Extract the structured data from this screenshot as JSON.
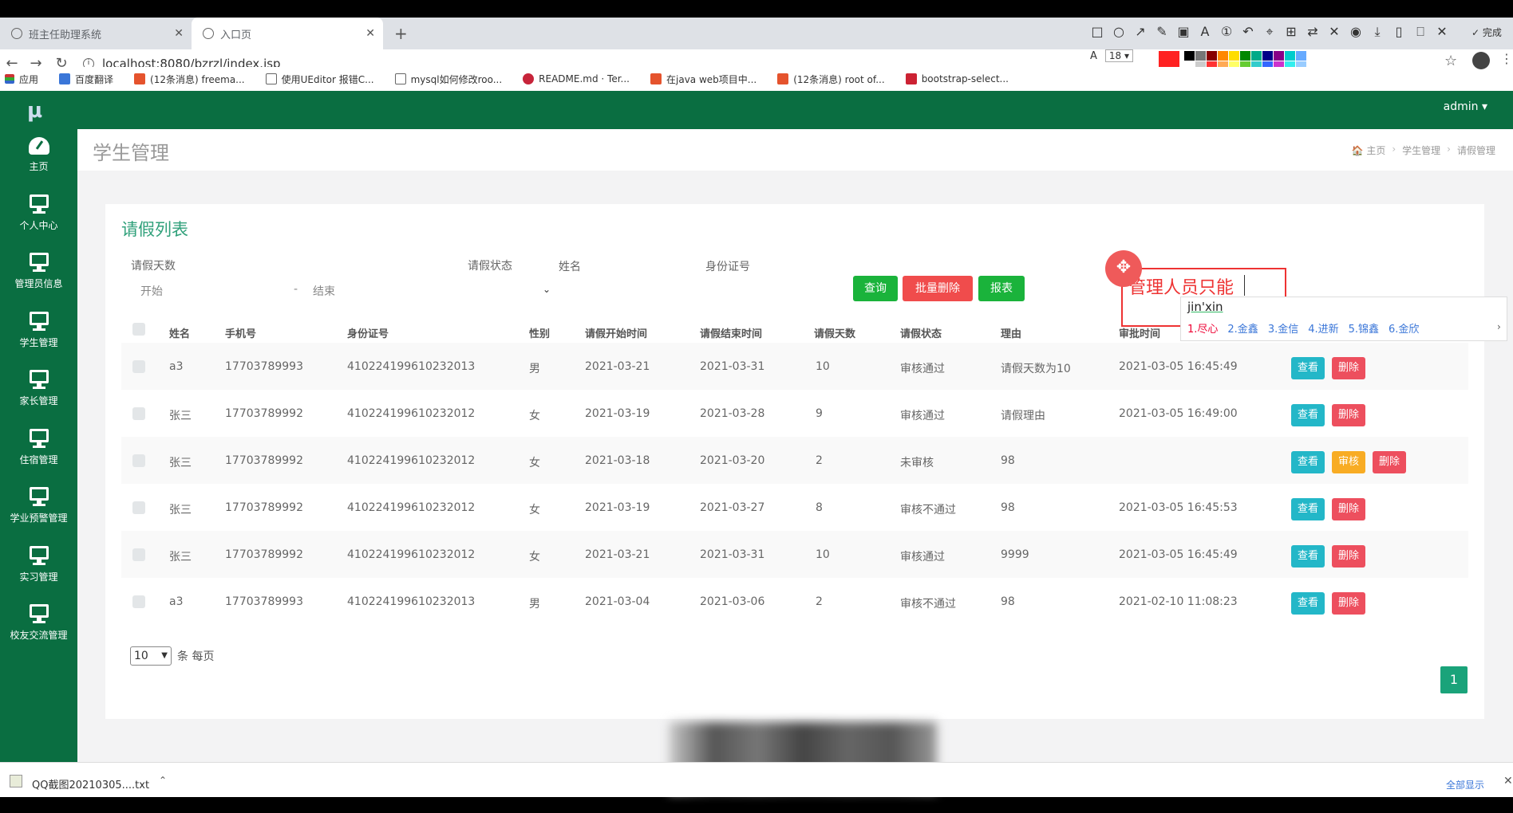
{
  "browser": {
    "tabs": [
      {
        "label": "班主任助理系统"
      },
      {
        "label": "入口页"
      }
    ],
    "url": "localhost:8080/bzrzl/index.jsp",
    "bookmarks": [
      "应用",
      "百度翻译",
      "(12条消息) freema...",
      "使用UEditor 报错C...",
      "mysql如何修改roo...",
      "README.md · Ter...",
      "在java web项目中...",
      "(12条消息) root of...",
      "bootstrap-select..."
    ],
    "snap_tool": {
      "done_label": "完成",
      "font_size": "18"
    }
  },
  "header": {
    "logo": "μ",
    "user": "admin ▾"
  },
  "sidebar": {
    "items": [
      {
        "label": "主页",
        "icon": "dashboard-icon"
      },
      {
        "label": "个人中心",
        "icon": "monitor-icon"
      },
      {
        "label": "管理员信息",
        "icon": "monitor-icon"
      },
      {
        "label": "学生管理",
        "icon": "monitor-icon"
      },
      {
        "label": "家长管理",
        "icon": "monitor-icon"
      },
      {
        "label": "住宿管理",
        "icon": "monitor-icon"
      },
      {
        "label": "学业预警管理",
        "icon": "monitor-icon"
      },
      {
        "label": "实习管理",
        "icon": "monitor-icon"
      },
      {
        "label": "校友交流管理",
        "icon": "monitor-icon"
      }
    ]
  },
  "page": {
    "title": "学生管理",
    "breadcrumbs": [
      "🏠 主页",
      "学生管理",
      "请假管理"
    ]
  },
  "card": {
    "title": "请假列表"
  },
  "filters": {
    "days_label": "请假天数",
    "days_start_placeholder": "开始",
    "days_dash": "-",
    "days_end_placeholder": "结束",
    "status_label": "请假状态",
    "name_label": "姓名",
    "idcard_label": "身份证号",
    "search_button": "查询",
    "batch_delete_button": "批量删除",
    "report_button": "报表"
  },
  "annotation": {
    "text": "管理人员只能",
    "ime_input": "jin'xin",
    "ime_candidates": [
      "1.尽心",
      "2.金鑫",
      "3.金信",
      "4.进新",
      "5.锦鑫",
      "6.金欣"
    ]
  },
  "table": {
    "columns": [
      "姓名",
      "手机号",
      "身份证号",
      "性别",
      "请假开始时间",
      "请假结束时间",
      "请假天数",
      "请假状态",
      "理由",
      "审批时间"
    ],
    "rows": [
      {
        "name": "a3",
        "phone": "17703789993",
        "idcard": "410224199610232013",
        "gender": "男",
        "start": "2021-03-21",
        "end": "2021-03-31",
        "days": "10",
        "status": "审核通过",
        "reason": "请假天数为10",
        "approved": "2021-03-05 16:45:49",
        "actions": [
          "查看",
          "删除"
        ]
      },
      {
        "name": "张三",
        "phone": "17703789992",
        "idcard": "410224199610232012",
        "gender": "女",
        "start": "2021-03-19",
        "end": "2021-03-28",
        "days": "9",
        "status": "审核通过",
        "reason": "请假理由",
        "approved": "2021-03-05 16:49:00",
        "actions": [
          "查看",
          "删除"
        ]
      },
      {
        "name": "张三",
        "phone": "17703789992",
        "idcard": "410224199610232012",
        "gender": "女",
        "start": "2021-03-18",
        "end": "2021-03-20",
        "days": "2",
        "status": "未审核",
        "reason": "98",
        "approved": "",
        "actions": [
          "查看",
          "审核",
          "删除"
        ]
      },
      {
        "name": "张三",
        "phone": "17703789992",
        "idcard": "410224199610232012",
        "gender": "女",
        "start": "2021-03-19",
        "end": "2021-03-27",
        "days": "8",
        "status": "审核不通过",
        "reason": "98",
        "approved": "2021-03-05 16:45:53",
        "actions": [
          "查看",
          "删除"
        ]
      },
      {
        "name": "张三",
        "phone": "17703789992",
        "idcard": "410224199610232012",
        "gender": "女",
        "start": "2021-03-21",
        "end": "2021-03-31",
        "days": "10",
        "status": "审核通过",
        "reason": "9999",
        "approved": "2021-03-05 16:45:49",
        "actions": [
          "查看",
          "删除"
        ]
      },
      {
        "name": "a3",
        "phone": "17703789993",
        "idcard": "410224199610232013",
        "gender": "男",
        "start": "2021-03-04",
        "end": "2021-03-06",
        "days": "2",
        "status": "审核不通过",
        "reason": "98",
        "approved": "2021-02-10 11:08:23",
        "actions": [
          "查看",
          "删除"
        ]
      }
    ]
  },
  "pagination": {
    "page_size": "10",
    "page_size_suffix": "条 每页",
    "current_page": "1"
  },
  "download_bar": {
    "file": "QQ截图20210305....txt",
    "show_all": "全部显示"
  },
  "colors": {
    "brand_green": "#0a6e41",
    "title_green": "#2fa07a",
    "view_button": "#23b7c8",
    "delete_button": "#ed4f5e",
    "audit_button": "#f8ac24",
    "annotation_red": "#e33333"
  }
}
